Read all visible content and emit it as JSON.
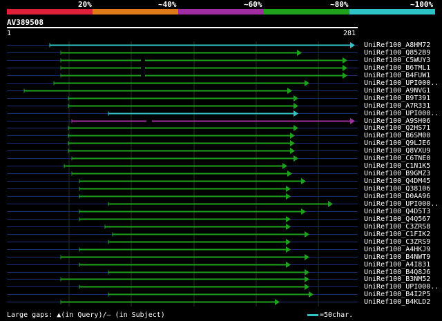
{
  "header": {
    "percent_labels": [
      "20%",
      "~40%",
      "~60%",
      "~80%",
      "~100%"
    ],
    "colors": [
      "#e0203a",
      "#e07a18",
      "#a02ea0",
      "#1ea21e",
      "#2ec4c6"
    ],
    "query_id": "AV389508",
    "scale_start": "1",
    "scale_end": "281"
  },
  "hits": [
    {
      "label": "UniRef100_A8HM72",
      "color": "cyan"
    },
    {
      "label": "UniRef100_Q852B9",
      "color": "green"
    },
    {
      "label": "UniRef100_C5WUY3",
      "color": "green"
    },
    {
      "label": "UniRef100_B6TML1",
      "color": "green"
    },
    {
      "label": "UniRef100_B4FUW1",
      "color": "green"
    },
    {
      "label": "UniRef100_UPI000..",
      "color": "green"
    },
    {
      "label": "UniRef100_A9NVG1",
      "color": "green"
    },
    {
      "label": "UniRef100_B9T391",
      "color": "green"
    },
    {
      "label": "UniRef100_A7R331",
      "color": "green"
    },
    {
      "label": "UniRef100_UPI000..",
      "color": "cyan"
    },
    {
      "label": "UniRef100_A9SH06",
      "color": "purple"
    },
    {
      "label": "UniRef100_Q2HS71",
      "color": "green"
    },
    {
      "label": "UniRef100_B6SM00",
      "color": "green"
    },
    {
      "label": "UniRef100_Q9LJE6",
      "color": "green"
    },
    {
      "label": "UniRef100_Q8VXU9",
      "color": "green"
    },
    {
      "label": "UniRef100_C6TNE0",
      "color": "green"
    },
    {
      "label": "UniRef100_C1N1K5",
      "color": "green"
    },
    {
      "label": "UniRef100_B9GMZ3",
      "color": "green"
    },
    {
      "label": "UniRef100_Q4DM45",
      "color": "green"
    },
    {
      "label": "UniRef100_Q38106",
      "color": "green"
    },
    {
      "label": "UniRef100_D0AA96",
      "color": "green"
    },
    {
      "label": "UniRef100_UPI000..",
      "color": "green"
    },
    {
      "label": "UniRef100_Q4D5T3",
      "color": "green"
    },
    {
      "label": "UniRef100_Q4Q567",
      "color": "green"
    },
    {
      "label": "UniRef100_C3ZRS8",
      "color": "green"
    },
    {
      "label": "UniRef100_C1FIK2",
      "color": "green"
    },
    {
      "label": "UniRef100_C3ZRS9",
      "color": "green"
    },
    {
      "label": "UniRef100_A4HKJ9",
      "color": "green"
    },
    {
      "label": "UniRef100_B4NWT9",
      "color": "green"
    },
    {
      "label": "UniRef100_A4I831",
      "color": "green"
    },
    {
      "label": "UniRef100_B4Q8J6",
      "color": "green"
    },
    {
      "label": "UniRef100_B3NM52",
      "color": "green"
    },
    {
      "label": "UniRef100_UPI000..",
      "color": "green"
    },
    {
      "label": "UniRef100_B4I2P5",
      "color": "green"
    },
    {
      "label": "UniRef100_B4KLD2",
      "color": "green"
    }
  ],
  "footer": {
    "legend_text": "Large gaps: ▲(in Query)/— (in Subject)",
    "scale_text": "=50char."
  }
}
